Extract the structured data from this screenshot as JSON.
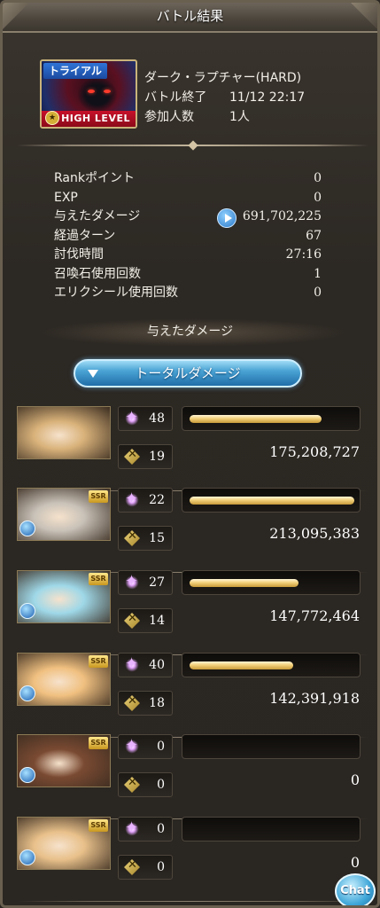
{
  "header": {
    "title": "バトル結果"
  },
  "quest": {
    "tag": "トライアル",
    "level_label": "HIGH LEVEL",
    "name": "ダーク・ラプチャー(HARD)",
    "end_label": "バトル終了",
    "end_time": "11/12 22:17",
    "participants_label": "参加人数",
    "participants": "1人"
  },
  "stats": [
    {
      "label": "Rankポイント",
      "value": "0"
    },
    {
      "label": "EXP",
      "value": "0"
    },
    {
      "label": "与えたダメージ",
      "value": "691,702,225"
    },
    {
      "label": "経過ターン",
      "value": "67"
    },
    {
      "label": "討伐時間",
      "value": "27:16"
    },
    {
      "label": "召喚石使用回数",
      "value": "1"
    },
    {
      "label": "エリクシール使用回数",
      "value": "0"
    }
  ],
  "damage_section": {
    "title": "与えたダメージ",
    "total_button": "トータルダメージ"
  },
  "characters": [
    {
      "ability_uses": "48",
      "turns": "19",
      "damage": "175,208,727",
      "bar_fraction": 0.8,
      "ssr": "",
      "palette": "#d9b27a"
    },
    {
      "ability_uses": "22",
      "turns": "15",
      "damage": "213,095,383",
      "bar_fraction": 1.0,
      "ssr": "SSR",
      "palette": "#c9c2b8"
    },
    {
      "ability_uses": "27",
      "turns": "14",
      "damage": "147,772,464",
      "bar_fraction": 0.66,
      "ssr": "SSR",
      "palette": "#9fd8e8"
    },
    {
      "ability_uses": "40",
      "turns": "18",
      "damage": "142,391,918",
      "bar_fraction": 0.63,
      "ssr": "SSR",
      "palette": "#f0c080"
    },
    {
      "ability_uses": "0",
      "turns": "0",
      "damage": "0",
      "bar_fraction": 0.0,
      "ssr": "SSR",
      "palette": "#7a4a32"
    },
    {
      "ability_uses": "0",
      "turns": "0",
      "damage": "0",
      "bar_fraction": 0.0,
      "ssr": "SSR",
      "palette": "#e8c08a"
    }
  ],
  "chat_button": "Chat"
}
